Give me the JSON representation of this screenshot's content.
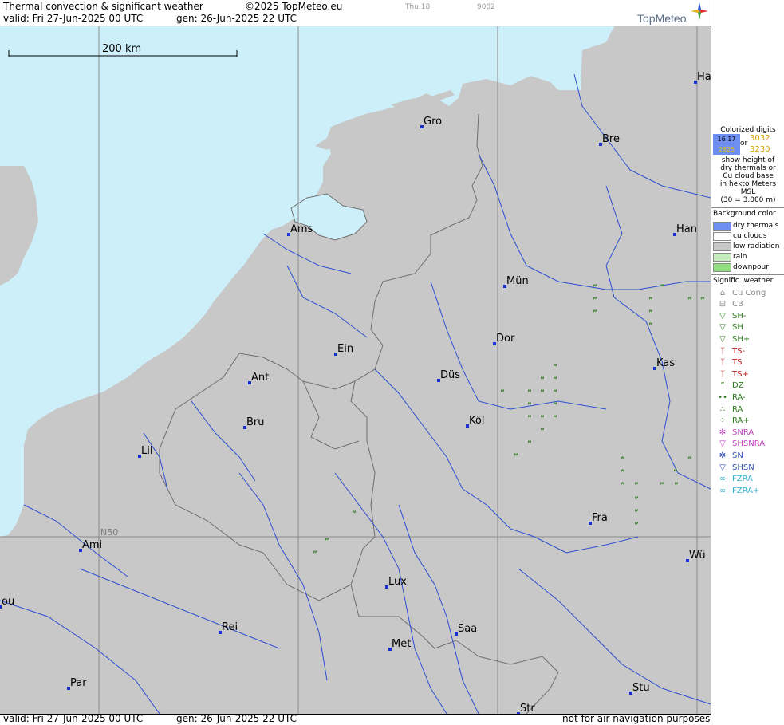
{
  "header": {
    "title": "Thermal convection & significant weather",
    "copyright": "©2025 TopMeteo.eu",
    "day": "Thu 18",
    "code": "9002",
    "valid": "valid:  Fri  27-Jun-2025  00 UTC",
    "gen": "gen: 26-Jun-2025 22 UTC",
    "logo_text": "TopMeteo"
  },
  "footer": {
    "valid": "valid:  Fri  27-Jun-2025  00 UTC",
    "gen": "gen: 26-Jun-2025 22 UTC",
    "disclaimer": "not for air navigation purposes"
  },
  "map": {
    "scale_label": "200 km",
    "lat_label": "N50",
    "colors": {
      "sea": "#cdeff9",
      "land": "#c8c8c8",
      "rivers": "#2d4fd0",
      "borders": "#6e6e6e",
      "drizzle": "#2e7d1f"
    },
    "cities": [
      "Ha",
      "Gro",
      "Bre",
      "Ams",
      "Han",
      "Mün",
      "Dor",
      "Ein",
      "Kas",
      "Ant",
      "Düs",
      "Bru",
      "Köl",
      "Lil",
      "Fra",
      "Ami",
      "Wü",
      "Lux",
      "ou",
      "Rei",
      "Saa",
      "Met",
      "Stu",
      "Par",
      "Str"
    ],
    "drizzle_symbol": "”"
  },
  "legend": {
    "colorized_title": "Colorized digits",
    "digit_blue": "16 17",
    "digit_gold1": "3032",
    "digit_or": "or",
    "digit_white": "2825",
    "digit_gold2": "3230",
    "desc1": "show height of",
    "desc2": "dry thermals or",
    "desc3": "Cu cloud base",
    "desc4": "in hekto Meters",
    "desc5": "MSL",
    "desc6": "(30 = 3.000 m)",
    "bg_title": "Background color",
    "bg_items": [
      {
        "label": "dry thermals",
        "color": "#6f8ff0"
      },
      {
        "label": "cu clouds",
        "color": "#ffffff"
      },
      {
        "label": "low radiation",
        "color": "#c8c8c8"
      },
      {
        "label": "rain",
        "color": "#c6ecc0"
      },
      {
        "label": "downpour",
        "color": "#90e080"
      }
    ],
    "wx_title": "Signific. weather",
    "wx_items": [
      {
        "label": "Cu Cong",
        "icon": "cu-cong-icon",
        "color": "#888888"
      },
      {
        "label": "CB",
        "icon": "cb-icon",
        "color": "#888888"
      },
      {
        "label": "SH-",
        "icon": "shower-light-icon",
        "color": "#2e7d1f"
      },
      {
        "label": "SH",
        "icon": "shower-icon",
        "color": "#2e7d1f"
      },
      {
        "label": "SH+",
        "icon": "shower-heavy-icon",
        "color": "#2e7d1f"
      },
      {
        "label": "TS-",
        "icon": "thunder-light-icon",
        "color": "#c02020"
      },
      {
        "label": "TS",
        "icon": "thunder-icon",
        "color": "#c02020"
      },
      {
        "label": "TS+",
        "icon": "thunder-heavy-icon",
        "color": "#c02020"
      },
      {
        "label": "DZ",
        "icon": "drizzle-icon",
        "color": "#2e7d1f"
      },
      {
        "label": "RA-",
        "icon": "rain-light-icon",
        "color": "#2e7d1f"
      },
      {
        "label": "RA",
        "icon": "rain-icon",
        "color": "#2e7d1f"
      },
      {
        "label": "RA+",
        "icon": "rain-heavy-icon",
        "color": "#2e7d1f"
      },
      {
        "label": "SNRA",
        "icon": "snow-rain-icon",
        "color": "#c040c0"
      },
      {
        "label": "SHSNRA",
        "icon": "snow-rain-shower-icon",
        "color": "#c040c0"
      },
      {
        "label": "SN",
        "icon": "snow-icon",
        "color": "#3050c0"
      },
      {
        "label": "SHSN",
        "icon": "snow-shower-icon",
        "color": "#3050c0"
      },
      {
        "label": "FZRA",
        "icon": "freezing-rain-icon",
        "color": "#30b0d0"
      },
      {
        "label": "FZRA+",
        "icon": "freezing-rain-heavy-icon",
        "color": "#30b0d0"
      }
    ]
  }
}
